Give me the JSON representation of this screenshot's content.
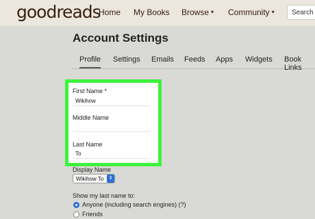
{
  "header": {
    "logo": "goodreads",
    "nav": [
      {
        "label": "Home",
        "has_menu": false
      },
      {
        "label": "My Books",
        "has_menu": false
      },
      {
        "label": "Browse",
        "has_menu": true
      },
      {
        "label": "Community",
        "has_menu": true
      }
    ],
    "caret": "▾",
    "search_text": "Search b"
  },
  "page": {
    "title": "Account Settings",
    "tabs": [
      "Profile",
      "Settings",
      "Emails",
      "Feeds",
      "Apps",
      "Widgets",
      "Book Links"
    ],
    "active_tab": "Profile"
  },
  "form": {
    "first_name_label": "First Name *",
    "first_name_value": "Wikihow",
    "middle_name_label": "Middle Name",
    "middle_name_value": "",
    "last_name_label": "Last Name",
    "last_name_value": "To",
    "display_name_label": "Display Name",
    "display_name_value": "Wikihow To",
    "show_last_name_label": "Show my last name to:",
    "options": [
      {
        "label": "Anyone (including search engines) (?)",
        "selected": true
      },
      {
        "label": "Friends",
        "selected": false
      }
    ]
  },
  "colors": {
    "highlight": "#3df23d",
    "header_bg": "#ebe7de",
    "radio_accent": "#2f6fd6"
  }
}
